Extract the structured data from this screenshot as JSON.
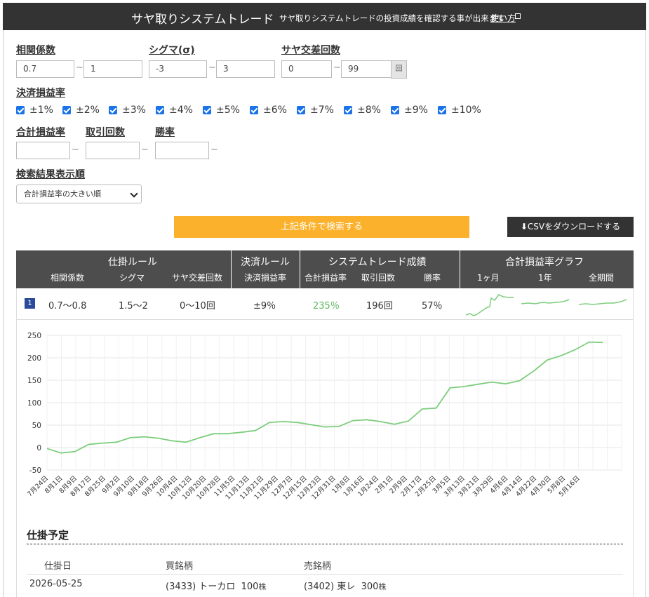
{
  "header": {
    "title": "サヤ取りシステムトレード",
    "subtitle": "サヤ取りシステムトレードの投資成績を確認する事が出来ます",
    "help_link": "使い方"
  },
  "filters": {
    "correlation": {
      "label": "相関係数",
      "min": "0.7",
      "max": "1"
    },
    "sigma": {
      "label": "シグマ(σ)",
      "min": "-3",
      "max": "3"
    },
    "crossings": {
      "label": "サヤ交差回数",
      "min": "0",
      "max": "99",
      "unit": "回"
    },
    "tilde": "~",
    "settlement": {
      "label": "決済損益率",
      "options": [
        {
          "label": "±1%",
          "checked": true
        },
        {
          "label": "±2%",
          "checked": true
        },
        {
          "label": "±3%",
          "checked": true
        },
        {
          "label": "±4%",
          "checked": true
        },
        {
          "label": "±5%",
          "checked": true
        },
        {
          "label": "±6%",
          "checked": true
        },
        {
          "label": "±7%",
          "checked": true
        },
        {
          "label": "±8%",
          "checked": true
        },
        {
          "label": "±9%",
          "checked": true
        },
        {
          "label": "±10%",
          "checked": true
        }
      ]
    },
    "total_return": {
      "label": "合計損益率",
      "value": ""
    },
    "trade_count": {
      "label": "取引回数",
      "value": ""
    },
    "win_rate": {
      "label": "勝率",
      "value": ""
    },
    "sort": {
      "label": "検索結果表示順",
      "selected": "合計損益率の大きい順"
    }
  },
  "buttons": {
    "search": "上記条件で検索する",
    "csv": "CSVをダウンロードする"
  },
  "table": {
    "groups": {
      "entry_rule": "仕掛ルール",
      "exit_rule": "決済ルール",
      "results": "システムトレード成績",
      "graph": "合計損益率グラフ"
    },
    "columns": {
      "correlation": "相関係数",
      "sigma": "シグマ",
      "crossings": "サヤ交差回数",
      "exit_rate": "決済損益率",
      "total_return": "合計損益率",
      "trade_count": "取引回数",
      "win_rate": "勝率",
      "g1m": "1ヶ月",
      "g1y": "1年",
      "gall": "全期間"
    },
    "rows": [
      {
        "rank": "1",
        "correlation": "0.7～0.8",
        "sigma": "1.5～2",
        "crossings": "0～10回",
        "exit_rate": "±9％",
        "total_return": "235％",
        "trade_count": "196回",
        "win_rate": "57％"
      }
    ]
  },
  "colors": {
    "accent": "#fbb12b",
    "header_bg": "#333333",
    "positive": "#5cb85c",
    "line": "#7ccd7c"
  },
  "chart_data": {
    "type": "line",
    "title": "",
    "xlabel": "",
    "ylabel": "",
    "ylim": [
      -50,
      250
    ],
    "yticks": [
      -50,
      0,
      50,
      100,
      150,
      200,
      250
    ],
    "grid": true,
    "categories": [
      "7月24日",
      "8月1日",
      "8月9日",
      "8月17日",
      "8月25日",
      "9月2日",
      "9月10日",
      "9月18日",
      "9月26日",
      "10月4日",
      "10月12日",
      "10月20日",
      "10月28日",
      "11月5日",
      "11月13日",
      "11月21日",
      "11月29日",
      "12月7日",
      "12月15日",
      "12月23日",
      "12月31日",
      "1月8日",
      "1月16日",
      "1月24日",
      "2月1日",
      "2月9日",
      "2月17日",
      "2月25日",
      "3月5日",
      "3月13日",
      "3月21日",
      "3月29日",
      "4月6日",
      "4月14日",
      "4月22日",
      "4月30日",
      "5月8日",
      "5月16日"
    ],
    "series": [
      {
        "values": [
          -2,
          -12,
          -9,
          7,
          10,
          12,
          22,
          24,
          21,
          15,
          12,
          22,
          31,
          31,
          34,
          38,
          56,
          58,
          56,
          51,
          46,
          47,
          60,
          62,
          58,
          52,
          59,
          86,
          88,
          133,
          136,
          141,
          146,
          142,
          149,
          170,
          195,
          205,
          218,
          235,
          234
        ]
      }
    ]
  },
  "schedule": {
    "title": "仕掛予定",
    "headers": {
      "date": "仕掛日",
      "buy": "買銘柄",
      "sell": "売銘柄"
    },
    "rows": [
      {
        "date": "2026-05-25",
        "buy": "(3433) トーカロ",
        "buy_qty": "100",
        "sell": "(3402) 東レ",
        "sell_qty": "300",
        "unit": "株"
      }
    ]
  }
}
